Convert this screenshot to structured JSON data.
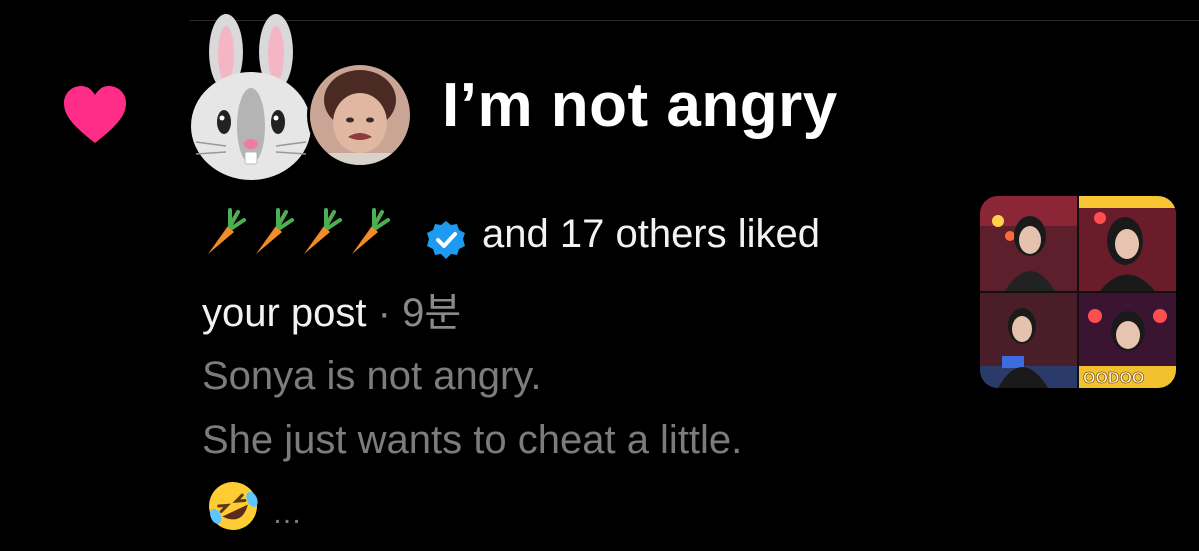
{
  "notification": {
    "title": "I’m not angry",
    "liked_text": "and 17 others liked",
    "liked_text_2": "your post",
    "separator": " · ",
    "time": "9분",
    "preview_line1": "Sonya is not angry.",
    "preview_line2": "She just wants to cheat a little.",
    "ellipsis": "…"
  },
  "icons": {
    "heart": "heart-icon",
    "bunny": "rabbit-face-emoji",
    "carrot": "carrot-emoji",
    "verified": "verified-badge-icon",
    "laugh": "rolling-laughing-emoji"
  },
  "colors": {
    "background": "#000000",
    "heart": "#ff2d87",
    "verified": "#1d9bf0",
    "primary_text": "#f2f2f2",
    "secondary_text": "#7c7c7c"
  }
}
